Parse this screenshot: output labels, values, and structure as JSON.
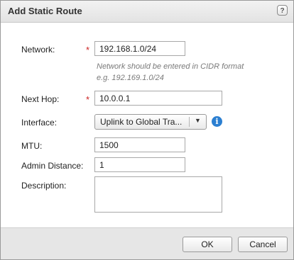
{
  "dialog": {
    "title": "Add Static Route",
    "help_glyph": "?"
  },
  "form": {
    "network": {
      "label": "Network:",
      "required_mark": "*",
      "value": "192.168.1.0/24",
      "hint_line1": "Network should be entered in CIDR format",
      "hint_line2": "e.g. 192.169.1.0/24"
    },
    "next_hop": {
      "label": "Next Hop:",
      "required_mark": "*",
      "value": "10.0.0.1"
    },
    "interface": {
      "label": "Interface:",
      "selected": "Uplink to Global Tra...",
      "arrow": "▼",
      "info_glyph": "i"
    },
    "mtu": {
      "label": "MTU:",
      "value": "1500"
    },
    "admin_distance": {
      "label": "Admin Distance:",
      "value": "1"
    },
    "description": {
      "label": "Description:",
      "value": ""
    }
  },
  "footer": {
    "ok_label": "OK",
    "cancel_label": "Cancel"
  },
  "colors": {
    "required": "#cc2222",
    "info_icon": "#2b7fd1",
    "footer_bg": "#e6e6e6"
  },
  "icons": {
    "help": "help-icon",
    "info": "info-icon",
    "dropdown": "chevron-down-icon"
  }
}
